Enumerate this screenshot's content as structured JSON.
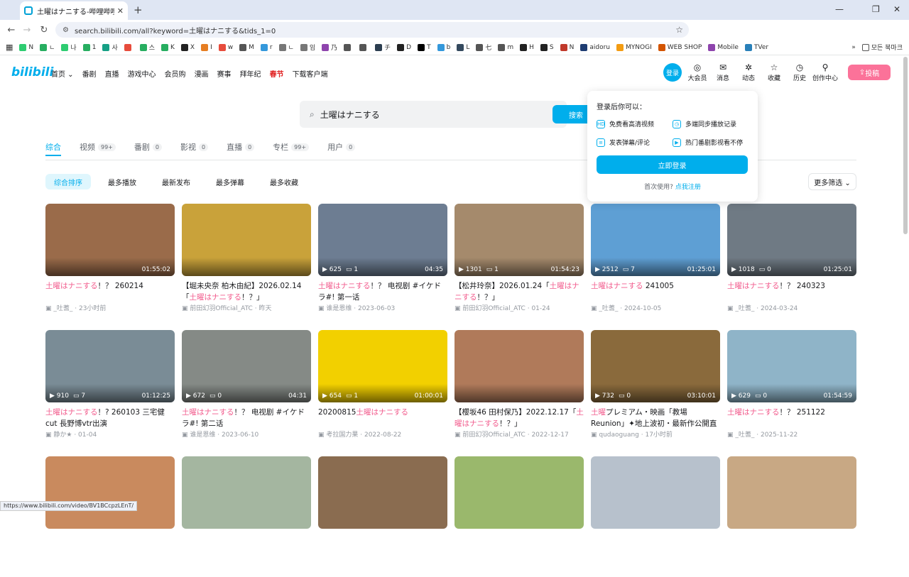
{
  "browser": {
    "tab_title": "土曜はナニする-哔哩哔哩_bilibili",
    "url": "search.bilibili.com/all?keyword=土曜はナニする&tids_1=0",
    "bookmarks": [
      "N",
      "ㄴ",
      "나",
      "1",
      "사",
      "",
      "스",
      "K",
      "X",
      "I",
      "w",
      "M",
      "r",
      "ㄴ",
      "임",
      "乃",
      "",
      "",
      "チ",
      "D",
      "T",
      "b",
      "L",
      "七",
      "m",
      "H",
      "S",
      "N",
      "aidoru",
      "MYNOGI",
      "WEB SHOP",
      "Mobile",
      "TVer"
    ],
    "bookmark_folder": "모든 북마크",
    "status_url": "https://www.bilibili.com/video/BV1BCcpzLEnT/"
  },
  "header": {
    "logo": "bilibili",
    "nav": [
      "首页 ⌄",
      "番剧",
      "直播",
      "游戏中心",
      "会员购",
      "漫画",
      "赛事",
      "拜年纪",
      "春节",
      "下载客户端"
    ],
    "login": "登录",
    "icons": [
      {
        "label": "大会员",
        "glyph": "◎"
      },
      {
        "label": "消息",
        "glyph": "✉"
      },
      {
        "label": "动态",
        "glyph": "✲"
      },
      {
        "label": "收藏",
        "glyph": "☆"
      },
      {
        "label": "历史",
        "glyph": "◷"
      },
      {
        "label": "创作中心",
        "glyph": "⚲"
      }
    ],
    "upload": "投稿"
  },
  "search": {
    "query": "土曜はナニする",
    "button": "搜索"
  },
  "tabs": [
    {
      "label": "综合",
      "count": ""
    },
    {
      "label": "视频",
      "count": "99+"
    },
    {
      "label": "番剧",
      "count": "0"
    },
    {
      "label": "影视",
      "count": "0"
    },
    {
      "label": "直播",
      "count": "0"
    },
    {
      "label": "专栏",
      "count": "99+"
    },
    {
      "label": "用户",
      "count": "0"
    }
  ],
  "sorts": [
    "综合排序",
    "最多播放",
    "最新发布",
    "最多弹幕",
    "最多收藏"
  ],
  "more_filter": "更多筛选 ⌄",
  "popup": {
    "heading": "登录后你可以：",
    "features": [
      "免费看高清视频",
      "多端同步播放记录",
      "发表弹幕/评论",
      "热门番剧影视看不停"
    ],
    "login_button": "立即登录",
    "first_use": "首次使用?",
    "register": "点我注册"
  },
  "videos": [
    {
      "hl": "土曜はナニする",
      "rest": "！？ 260214",
      "plays": "",
      "danmaku": "",
      "dur": "01:55:02",
      "author": "_吐蓍_",
      "date": "23小时前",
      "color": "#9a6b4a"
    },
    {
      "pre": "【堀未央奈 柏木由紀】2026.02.14「",
      "hl": "土曜はナニする",
      "rest": "！？」",
      "plays": "",
      "danmaku": "",
      "dur": "",
      "author": "前田幻羽Official_ATC",
      "date": "昨天",
      "color": "#c9a23a"
    },
    {
      "hl": "土曜はナニする",
      "rest": "！？ 电视剧 #イケドラ#! 第一话",
      "plays": "625",
      "danmaku": "1",
      "dur": "04:35",
      "author": "谁是恩维",
      "date": "2023-06-03",
      "color": "#6d7d92"
    },
    {
      "pre": "【松井玲奈】2026.01.24「",
      "hl": "土曜はナニする",
      "rest": "！？」",
      "plays": "1301",
      "danmaku": "1",
      "dur": "01:54:23",
      "author": "前田幻羽Official_ATC",
      "date": "01-24",
      "color": "#a58a6c"
    },
    {
      "hl": "土曜はナニする",
      "rest": " 241005",
      "plays": "2512",
      "danmaku": "7",
      "dur": "01:25:01",
      "author": "_吐蓍_",
      "date": "2024-10-05",
      "color": "#5e9fd4"
    },
    {
      "hl": "土曜はナニする",
      "rest": "！？ 240323",
      "plays": "1018",
      "danmaku": "0",
      "dur": "01:25:01",
      "author": "_吐蓍_",
      "date": "2024-03-24",
      "color": "#6f7a84"
    },
    {
      "hl": "土曜はナニする",
      "rest": "！? 260103 三宅健cut 長野博vtr出演",
      "plays": "910",
      "danmaku": "7",
      "dur": "01:12:25",
      "author": "静か★",
      "date": "01-04",
      "color": "#7a8c96"
    },
    {
      "hl": "土曜はナニする",
      "rest": "！？ 电视剧 #イケドラ#! 第二话",
      "plays": "672",
      "danmaku": "0",
      "dur": "04:31",
      "author": "谁是恩维",
      "date": "2023-06-10",
      "color": "#858a86"
    },
    {
      "pre": "20200815",
      "hl": "土曜はナニする",
      "rest": "",
      "plays": "654",
      "danmaku": "1",
      "dur": "01:00:01",
      "author": "考拉国力果",
      "date": "2022-08-22",
      "color": "#f2d000"
    },
    {
      "pre": "【櫻坂46 田村保乃】2022.12.17「",
      "hl": "土曜はナニする",
      "rest": "！？」",
      "plays": "",
      "danmaku": "",
      "dur": "",
      "author": "前田幻羽Official_ATC",
      "date": "2022-12-17",
      "color": "#b07a5a"
    },
    {
      "hl": "土曜",
      "rest": "プレミアム・映画「教場 Reunion」✦地上波初・最新作公開直前SP",
      "plays": "732",
      "danmaku": "0",
      "dur": "03:10:01",
      "author": "qudaoguang",
      "date": "17小时前",
      "color": "#8a6a3c"
    },
    {
      "hl": "土曜はナニする",
      "rest": "！？ 251122",
      "plays": "629",
      "danmaku": "0",
      "dur": "01:54:59",
      "author": "_吐蓍_",
      "date": "2025-11-22",
      "color": "#8fb4c8"
    },
    {
      "color": "#c98a5e"
    },
    {
      "color": "#a4b6a0"
    },
    {
      "color": "#8a6c50"
    },
    {
      "color": "#9ab86c"
    },
    {
      "color": "#b7c1cc"
    },
    {
      "color": "#c8a884"
    }
  ]
}
